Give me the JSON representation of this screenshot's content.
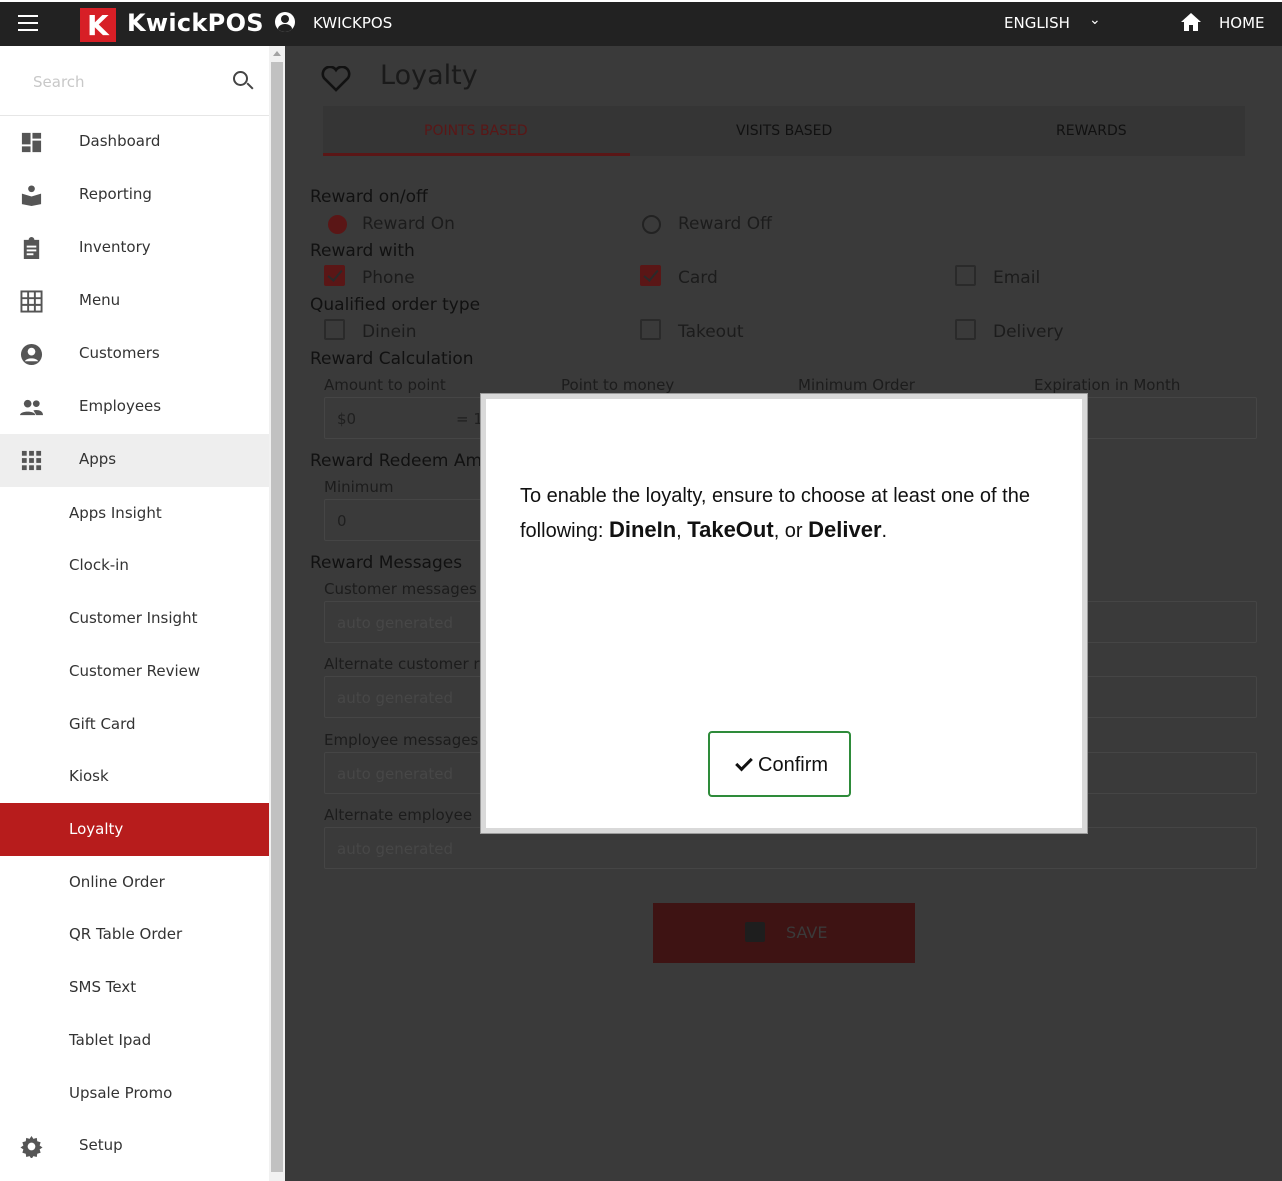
{
  "topbar": {
    "logo_letter": "K",
    "logo_text": "KwickPOS",
    "store_name": "KWICKPOS",
    "language": "ENGLISH",
    "home_label": "HOME"
  },
  "sidebar": {
    "search_placeholder": "Search",
    "items": [
      {
        "label": "Dashboard",
        "icon": "dashboard-icon"
      },
      {
        "label": "Reporting",
        "icon": "reporting-icon"
      },
      {
        "label": "Inventory",
        "icon": "clipboard-icon"
      },
      {
        "label": "Menu",
        "icon": "grid-icon"
      },
      {
        "label": "Customers",
        "icon": "account-circle-icon"
      },
      {
        "label": "Employees",
        "icon": "people-icon"
      },
      {
        "label": "Apps",
        "icon": "apps-icon"
      }
    ],
    "apps_subitems": [
      "Apps Insight",
      "Clock-in",
      "Customer Insight",
      "Customer Review",
      "Gift Card",
      "Kiosk",
      "Loyalty",
      "Online Order",
      "QR Table Order",
      "SMS Text",
      "Tablet Ipad",
      "Upsale Promo"
    ],
    "selected_subitem": "Loyalty",
    "setup_label": "Setup"
  },
  "page": {
    "title": "Loyalty",
    "tabs": [
      {
        "label": "POINTS BASED",
        "active": true
      },
      {
        "label": "VISITS BASED",
        "active": false
      },
      {
        "label": "REWARDS",
        "active": false
      }
    ],
    "reward_onoff_title": "Reward on/off",
    "reward_on": "Reward On",
    "reward_off": "Reward Off",
    "reward_on_selected": true,
    "reward_with_title": "Reward with",
    "reward_with": [
      {
        "label": "Phone",
        "checked": true
      },
      {
        "label": "Card",
        "checked": true
      },
      {
        "label": "Email",
        "checked": false
      }
    ],
    "order_type_title": "Qualified order type",
    "order_types": [
      {
        "label": "Dinein",
        "checked": false
      },
      {
        "label": "Takeout",
        "checked": false
      },
      {
        "label": "Delivery",
        "checked": false
      }
    ],
    "calc_title": "Reward Calculation",
    "calc_labels": [
      "Amount to point",
      "Point to money",
      "Minimum Order",
      "Expiration in Month"
    ],
    "amount_value": "$0",
    "amount_suffix": "= 1",
    "redeem_title": "Reward Redeem Amo",
    "redeem_min_label": "Minimum",
    "redeem_min_value": "0",
    "messages_title": "Reward Messages",
    "customer_messages_label": "Customer messages",
    "alt_customer_label": "Alternate customer r",
    "employee_messages_label": "Employee messages",
    "alt_employee_label": "Alternate employee",
    "auto_placeholder": "auto generated",
    "save_label": "SAVE"
  },
  "modal": {
    "text_before": "To enable the loyalty, ensure to choose at least one of the following: ",
    "opt1": "DineIn",
    "sep1": ", ",
    "opt2": "TakeOut",
    "sep2": ", or ",
    "opt3": "Deliver",
    "text_after": ".",
    "confirm_label": "Confirm",
    "confirm_border_color": "#2e8b3a"
  },
  "colors": {
    "brand_red": "#d71f26",
    "selected_red": "#b71c1c",
    "topbar": "#222222"
  }
}
